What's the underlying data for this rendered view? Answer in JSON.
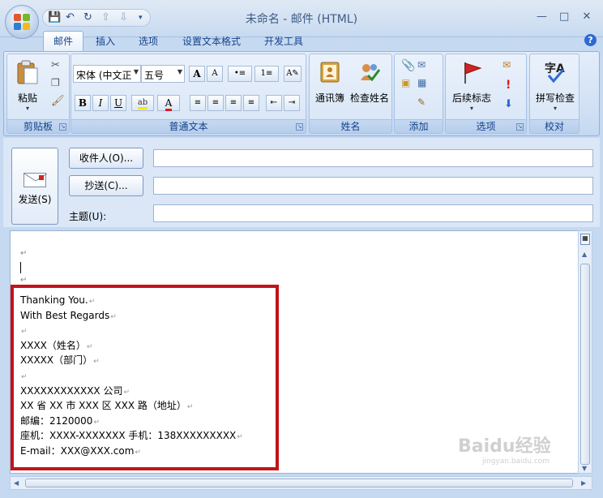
{
  "window": {
    "title": "未命名 - 邮件 (HTML)"
  },
  "tabs": [
    {
      "label": "邮件",
      "active": true
    },
    {
      "label": "插入"
    },
    {
      "label": "选项"
    },
    {
      "label": "设置文本格式"
    },
    {
      "label": "开发工具"
    }
  ],
  "ribbon": {
    "clipboard": {
      "label": "剪贴板",
      "paste": "粘贴"
    },
    "basic_text": {
      "label": "普通文本",
      "font_name": "宋体 (中文正",
      "font_size": "五号"
    },
    "names": {
      "label": "姓名",
      "address_book": "通讯簿",
      "check_names": "检查姓名"
    },
    "add": {
      "label": "添加"
    },
    "options": {
      "label": "选项",
      "follow_up": "后续标志"
    },
    "proofing": {
      "label": "校对",
      "spelling": "拼写检查"
    }
  },
  "compose": {
    "send_label": "发送(S)",
    "to_label": "收件人(O)...",
    "cc_label": "抄送(C)...",
    "subject_label": "主题(U):",
    "to_value": "",
    "cc_value": "",
    "subject_value": ""
  },
  "signature": {
    "lines": [
      "Thanking You.",
      "With Best Regards",
      "",
      "XXXX（姓名）",
      "XXXXX（部门）",
      "",
      "XXXXXXXXXXXX 公司",
      "XX 省 XX 市 XXX 区 XXX 路（地址）",
      "邮编：2120000",
      "座机：XXXX-XXXXXXX   手机：138XXXXXXXXX",
      "E-mail：XXX@XXX.com"
    ]
  },
  "watermark": {
    "text": "Baidu经验",
    "sub": "jingyan.baidu.com"
  },
  "colors": {
    "highlight_border": "#c2141b",
    "ribbon_text": "#15428b"
  }
}
